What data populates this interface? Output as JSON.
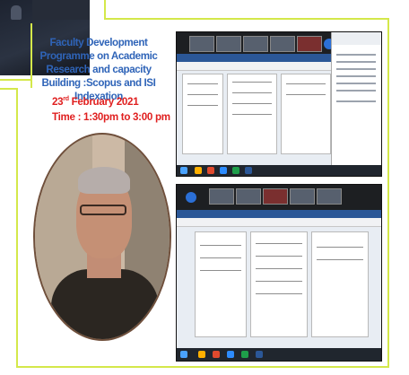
{
  "flyer": {
    "title": "Faculty Development Programme on Academic Research and capacity Building :Scopus and ISI Indexation",
    "date_day": "23",
    "date_suffix": "rd",
    "date_rest": " February 2021",
    "time": "Time : 1:30pm to 3:00 pm"
  },
  "colors": {
    "border_accent": "#d4e84a",
    "title_blue": "#2f64b8",
    "date_red": "#e01f1f"
  },
  "icons": [
    "gear-icon",
    "windows-start-icon"
  ]
}
